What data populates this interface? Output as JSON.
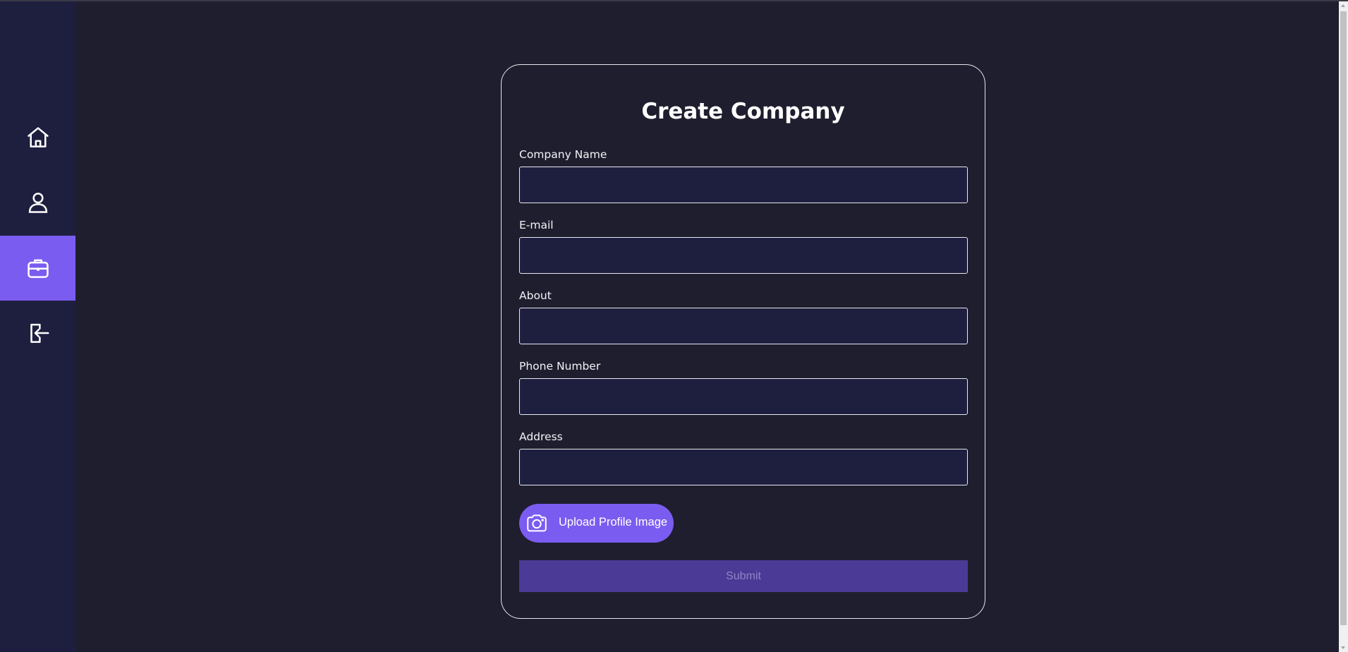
{
  "sidebar": {
    "items": [
      {
        "icon": "home-icon",
        "active": false
      },
      {
        "icon": "user-icon",
        "active": false
      },
      {
        "icon": "briefcase-icon",
        "active": true
      },
      {
        "icon": "logout-icon",
        "active": false
      }
    ]
  },
  "form": {
    "title": "Create Company",
    "fields": [
      {
        "label": "Company Name",
        "value": "",
        "placeholder": ""
      },
      {
        "label": "E-mail",
        "value": "",
        "placeholder": ""
      },
      {
        "label": "About",
        "value": "",
        "placeholder": ""
      },
      {
        "label": "Phone Number",
        "value": "",
        "placeholder": ""
      },
      {
        "label": "Address",
        "value": "",
        "placeholder": ""
      }
    ],
    "upload_label": "Upload Profile Image",
    "submit_label": "Submit"
  },
  "colors": {
    "accent": "#7b5cf0",
    "sidebar_bg": "#1e1f3f",
    "page_bg": "#1f1e2e",
    "submit_bg": "#4b3a96"
  }
}
